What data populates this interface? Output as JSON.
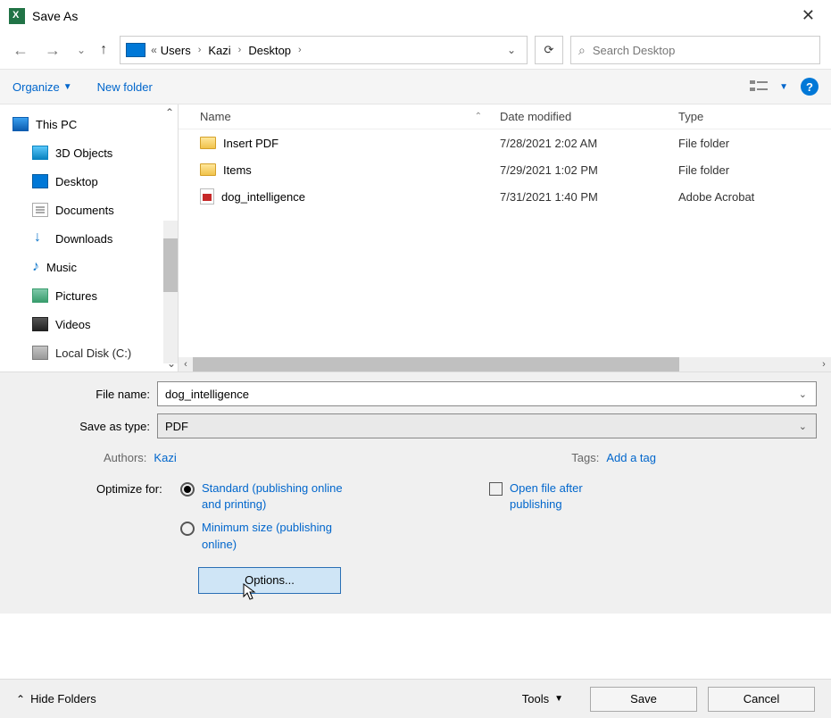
{
  "title": "Save As",
  "breadcrumb": {
    "prefix": "«",
    "items": [
      "Users",
      "Kazi",
      "Desktop"
    ]
  },
  "search": {
    "placeholder": "Search Desktop"
  },
  "toolbar": {
    "organize": "Organize",
    "new_folder": "New folder"
  },
  "tree": {
    "this_pc": "This PC",
    "items": [
      "3D Objects",
      "Desktop",
      "Documents",
      "Downloads",
      "Music",
      "Pictures",
      "Videos",
      "Local Disk (C:)"
    ]
  },
  "columns": {
    "name": "Name",
    "date": "Date modified",
    "type": "Type"
  },
  "files": [
    {
      "name": "Insert PDF",
      "date": "7/28/2021 2:02 AM",
      "type": "File folder",
      "icon": "folder"
    },
    {
      "name": "Items",
      "date": "7/29/2021 1:02 PM",
      "type": "File folder",
      "icon": "folder"
    },
    {
      "name": "dog_intelligence",
      "date": "7/31/2021 1:40 PM",
      "type": "Adobe Acrobat",
      "icon": "pdf"
    }
  ],
  "form": {
    "file_name_label": "File name:",
    "file_name_value": "dog_intelligence",
    "save_type_label": "Save as type:",
    "save_type_value": "PDF",
    "authors_label": "Authors:",
    "authors_value": "Kazi",
    "tags_label": "Tags:",
    "tags_value": "Add a tag",
    "optimize_label": "Optimize for:",
    "opt_standard": "Standard (publishing online and printing)",
    "opt_minimum": "Minimum size (publishing online)",
    "open_after": "Open file after publishing",
    "options_btn": "Options..."
  },
  "footer": {
    "hide_folders": "Hide Folders",
    "tools": "Tools",
    "save": "Save",
    "cancel": "Cancel"
  }
}
